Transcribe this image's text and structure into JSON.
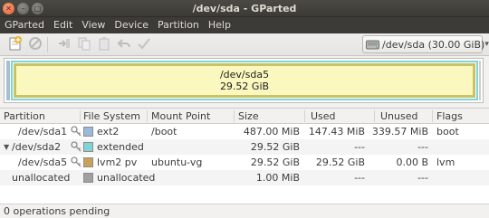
{
  "window": {
    "title": "/dev/sda - GParted",
    "controls": [
      "close",
      "minimize",
      "maximize"
    ]
  },
  "menu": [
    "GParted",
    "Edit",
    "View",
    "Device",
    "Partition",
    "Help"
  ],
  "toolbar": {
    "buttons": [
      "new-icon",
      "delete-icon",
      "resize-move-icon",
      "copy-icon",
      "paste-icon",
      "undo-icon",
      "apply-icon"
    ],
    "device_selector": {
      "label": "/dev/sda  (30.00 GiB)",
      "icon": "disk-icon"
    }
  },
  "graph": {
    "selected_partition": "/dev/sda5",
    "selected_size": "29.52 GiB",
    "colors": {
      "ext2": "#9cb8db",
      "extended": "#7fd5d5",
      "lvm2": "#c9c267",
      "unallocated": "#cfcfcf"
    }
  },
  "table": {
    "headers": [
      "Partition",
      "File System",
      "Mount Point",
      "Size",
      "Used",
      "Unused",
      "Flags"
    ],
    "rows": [
      {
        "partition": "/dev/sda1",
        "filesystem": "ext2",
        "fs_color": "#9cb8db",
        "mount": "/boot",
        "size": "487.00 MiB",
        "used": "147.43 MiB",
        "unused": "339.57 MiB",
        "flags": "boot"
      },
      {
        "partition": "/dev/sda2",
        "filesystem": "extended",
        "fs_color": "#7fd5d5",
        "mount": "",
        "size": "29.52 GiB",
        "used": "---",
        "unused": "---",
        "flags": ""
      },
      {
        "partition": "/dev/sda5",
        "filesystem": "lvm2 pv",
        "fs_color": "#c9a25a",
        "mount": "ubuntu-vg",
        "size": "29.52 GiB",
        "used": "29.52 GiB",
        "unused": "0.00 B",
        "flags": "lvm"
      },
      {
        "partition": "unallocated",
        "filesystem": "unallocated",
        "fs_color": "#a0a0a0",
        "mount": "",
        "size": "1.00 MiB",
        "used": "---",
        "unused": "---",
        "flags": ""
      }
    ]
  },
  "status": {
    "text": "0 operations pending"
  }
}
